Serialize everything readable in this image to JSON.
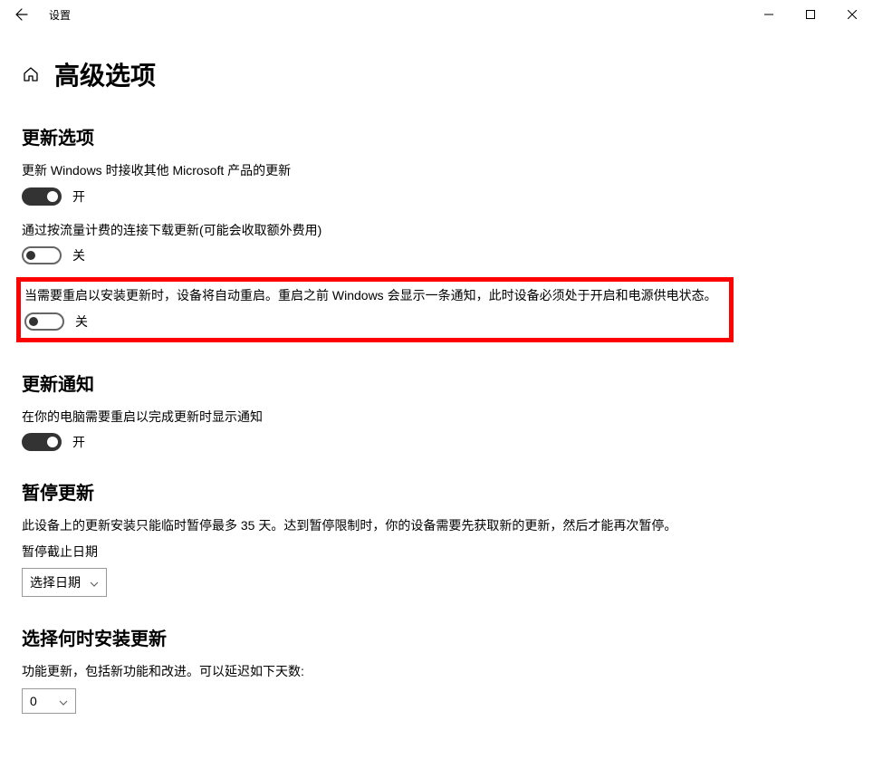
{
  "window": {
    "title": "设置"
  },
  "page": {
    "title": "高级选项"
  },
  "updateOptions": {
    "heading": "更新选项",
    "opt1": {
      "label": "更新 Windows 时接收其他 Microsoft 产品的更新",
      "state": "开"
    },
    "opt2": {
      "label": "通过按流量计费的连接下载更新(可能会收取额外费用)",
      "state": "关"
    },
    "opt3": {
      "label": "当需要重启以安装更新时，设备将自动重启。重启之前 Windows 会显示一条通知，此时设备必须处于开启和电源供电状态。",
      "state": "关"
    }
  },
  "updateNotifications": {
    "heading": "更新通知",
    "opt1": {
      "label": "在你的电脑需要重启以完成更新时显示通知",
      "state": "开"
    }
  },
  "pauseUpdates": {
    "heading": "暂停更新",
    "desc": "此设备上的更新安装只能临时暂停最多 35 天。达到暂停限制时，你的设备需要先获取新的更新，然后才能再次暂停。",
    "fieldLabel": "暂停截止日期",
    "dropdownText": "选择日期"
  },
  "chooseWhen": {
    "heading": "选择何时安装更新",
    "desc": "功能更新，包括新功能和改进。可以延迟如下天数:",
    "dropdownText": "0"
  }
}
